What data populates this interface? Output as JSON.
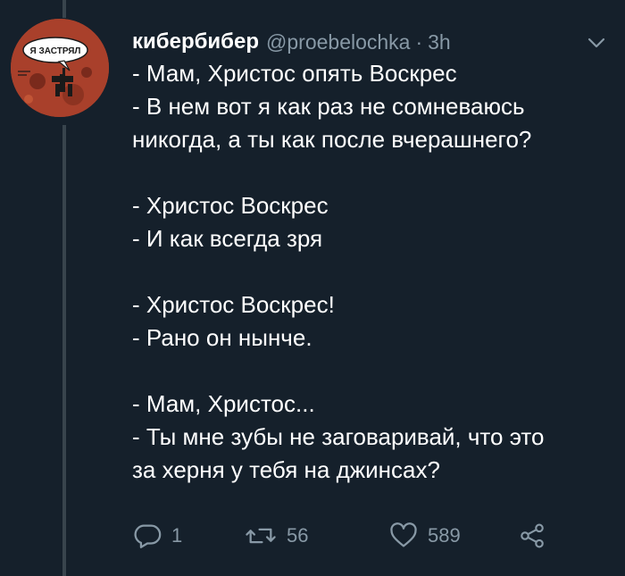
{
  "tweet": {
    "display_name": "кибербибер",
    "handle": "@proebelochka",
    "separator": "·",
    "time": "3h",
    "avatar_caption": "Я ЗАСТРЯЛ",
    "lines": [
      "- Мам, Христос опять Воскрес",
      "- В нем вот я как раз не сомневаюсь",
      "никогда, а ты как после вчерашнего?",
      "",
      "- Христос Воскрес",
      "- И как всегда зря",
      "",
      "- Христос Воскрес!",
      "- Рано он нынче.",
      "",
      "- Мам, Христос...",
      "- Ты мне зубы не заговаривай, что это",
      "за херня у тебя на джинсах?"
    ],
    "actions": {
      "reply_count": "1",
      "retweet_count": "56",
      "like_count": "589"
    }
  },
  "colors": {
    "background": "#15202b",
    "secondary_text": "#8899a6",
    "thread_line": "#38444d"
  },
  "icons": {
    "menu": "chevron-down-icon",
    "reply": "reply-icon",
    "retweet": "retweet-icon",
    "like": "heart-icon",
    "share": "share-icon"
  }
}
